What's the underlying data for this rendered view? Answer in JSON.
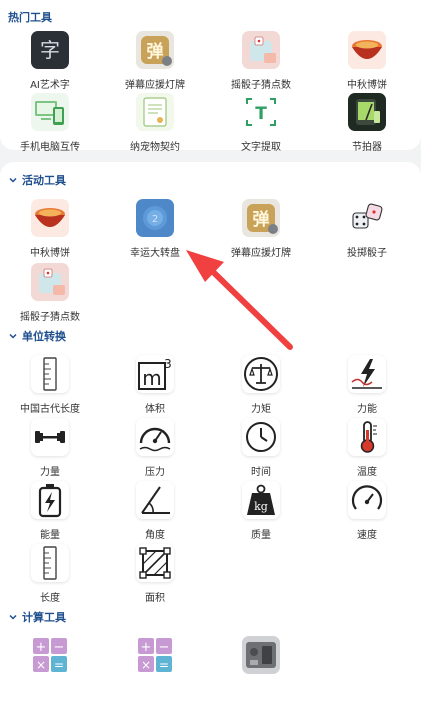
{
  "colors": {
    "section_title": "#1f4f8f",
    "arrow": "#f04040",
    "background": "#f2f3f5",
    "card": "#ffffff"
  },
  "hot": {
    "title": "热门工具",
    "items": [
      {
        "label": "AI艺术字",
        "icon": "ai-art-text-icon"
      },
      {
        "label": "弹幕应援灯牌",
        "icon": "danmaku-lightboard-icon"
      },
      {
        "label": "摇骰子猜点数",
        "icon": "dice-guess-icon"
      },
      {
        "label": "中秋博饼",
        "icon": "mooncake-bowl-icon"
      },
      {
        "label": "手机电脑互传",
        "icon": "phone-pc-transfer-icon"
      },
      {
        "label": "纳宠物契约",
        "icon": "pet-contract-icon"
      },
      {
        "label": "文字提取",
        "icon": "text-extract-icon"
      },
      {
        "label": "节拍器",
        "icon": "metronome-icon"
      }
    ]
  },
  "activity": {
    "title": "活动工具",
    "items": [
      {
        "label": "中秋博饼",
        "icon": "mooncake-bowl-icon"
      },
      {
        "label": "幸运大转盘",
        "icon": "lucky-wheel-icon"
      },
      {
        "label": "弹幕应援灯牌",
        "icon": "danmaku-lightboard-icon"
      },
      {
        "label": "投掷骰子",
        "icon": "dice-icon"
      },
      {
        "label": "摇骰子猜点数",
        "icon": "dice-guess-icon"
      }
    ]
  },
  "unit": {
    "title": "单位转换",
    "items": [
      {
        "label": "中国古代长度",
        "icon": "ruler-icon"
      },
      {
        "label": "体积",
        "icon": "cubic-meter-icon",
        "glyph": "m³"
      },
      {
        "label": "力矩",
        "icon": "balance-scale-icon"
      },
      {
        "label": "力能",
        "icon": "energy-bolt-icon"
      },
      {
        "label": "力量",
        "icon": "dumbbell-icon"
      },
      {
        "label": "压力",
        "icon": "pressure-gauge-icon"
      },
      {
        "label": "时间",
        "icon": "clock-icon"
      },
      {
        "label": "温度",
        "icon": "thermometer-icon"
      },
      {
        "label": "能量",
        "icon": "battery-icon"
      },
      {
        "label": "角度",
        "icon": "angle-icon"
      },
      {
        "label": "质量",
        "icon": "weight-kg-icon",
        "glyph": "kg"
      },
      {
        "label": "速度",
        "icon": "speedometer-icon"
      },
      {
        "label": "长度",
        "icon": "ruler-icon"
      },
      {
        "label": "面积",
        "icon": "area-icon"
      }
    ]
  },
  "calc": {
    "title": "计算工具",
    "items": [
      {
        "label": "",
        "icon": "calculator-icon"
      },
      {
        "label": "",
        "icon": "calculator-icon"
      },
      {
        "label": "",
        "icon": "abacus-icon"
      }
    ]
  }
}
